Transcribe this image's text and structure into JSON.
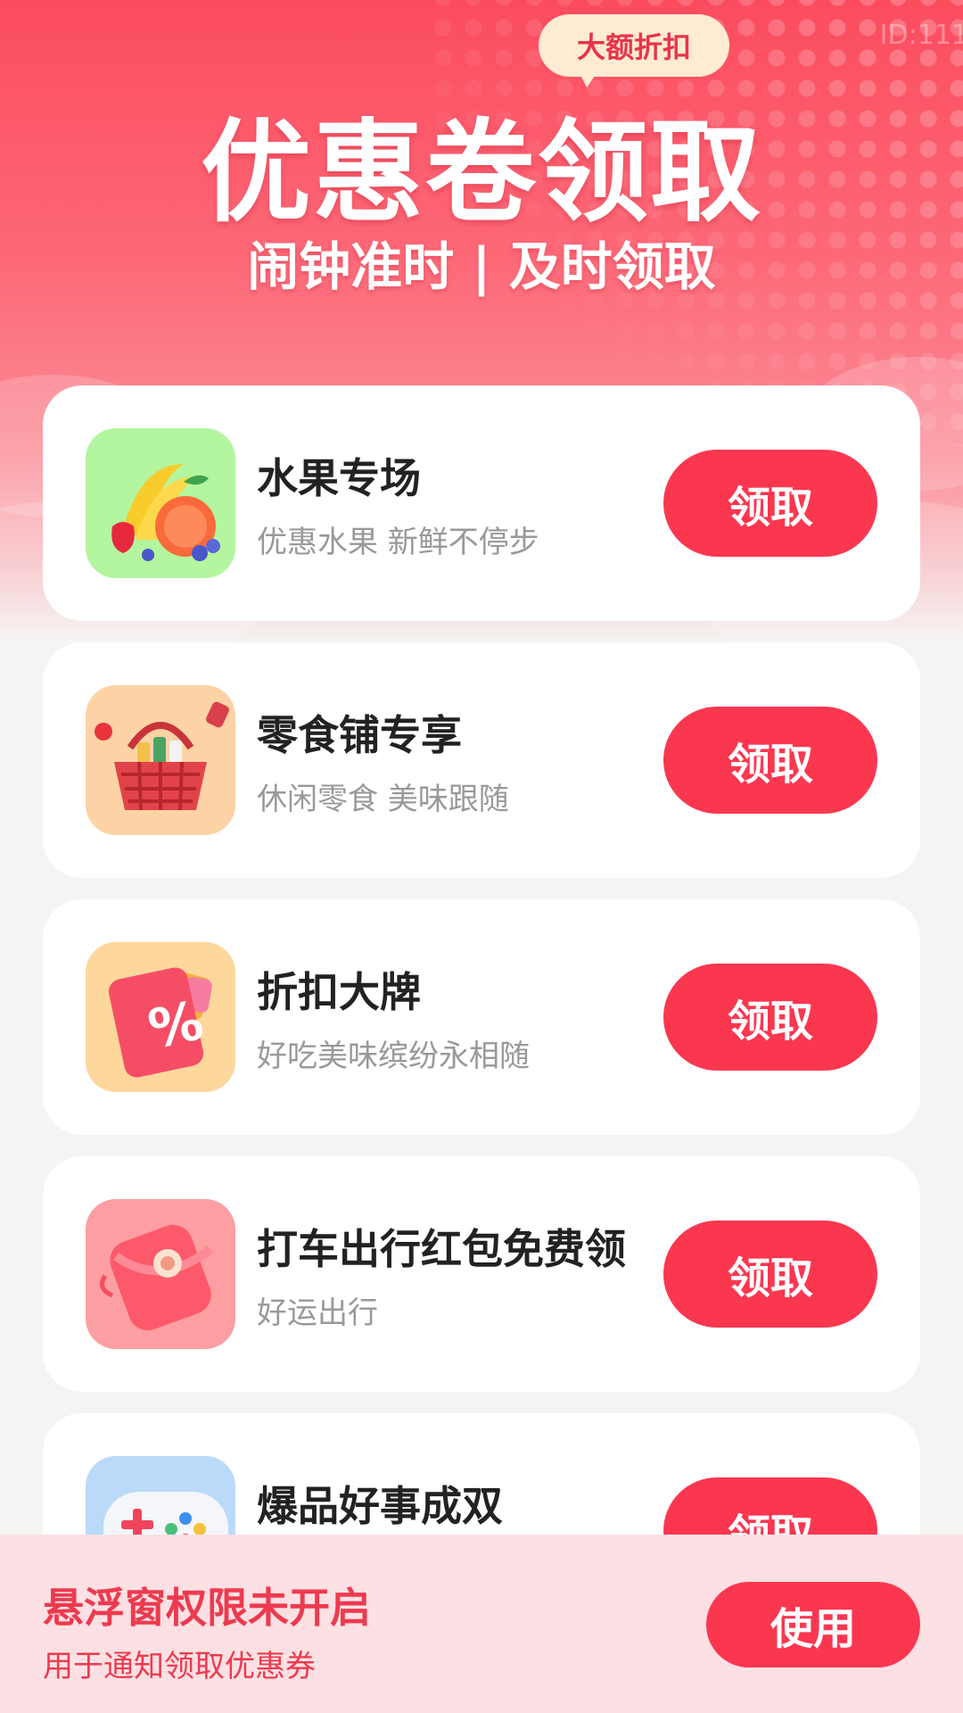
{
  "header": {
    "badge": "大额折扣",
    "id_label": "ID:111",
    "title": "优惠卷领取",
    "subtitle": "闹钟准时 | 及时领取"
  },
  "coupons": [
    {
      "title": "水果专场",
      "desc": "优惠水果 新鲜不停步",
      "button": "领取",
      "icon": "fruit-basket-icon",
      "bg": "#b4f5a0"
    },
    {
      "title": "零食铺专享",
      "desc": "休闲零食 美味跟随",
      "button": "领取",
      "icon": "shopping-basket-icon",
      "bg": "#fdd3a6"
    },
    {
      "title": "折扣大牌",
      "desc": "好吃美味缤纷永相随",
      "button": "领取",
      "icon": "discount-coupon-icon",
      "bg": "#fdd79c"
    },
    {
      "title": "打车出行红包免费领",
      "desc": "好运出行",
      "button": "领取",
      "icon": "red-envelope-icon",
      "bg": "#fc9ea2"
    },
    {
      "title": "爆品好事成双",
      "desc": "",
      "button": "领取",
      "icon": "game-controller-icon",
      "bg": "#b9daf9"
    }
  ],
  "banner": {
    "title": "悬浮窗权限未开启",
    "subtitle": "用于通知领取优惠券",
    "button": "使用"
  },
  "colors": {
    "accent": "#fb3750",
    "hero_top": "#fb4c5e",
    "banner_bg": "#fde0e3",
    "page_bg": "#f5f4f3"
  }
}
